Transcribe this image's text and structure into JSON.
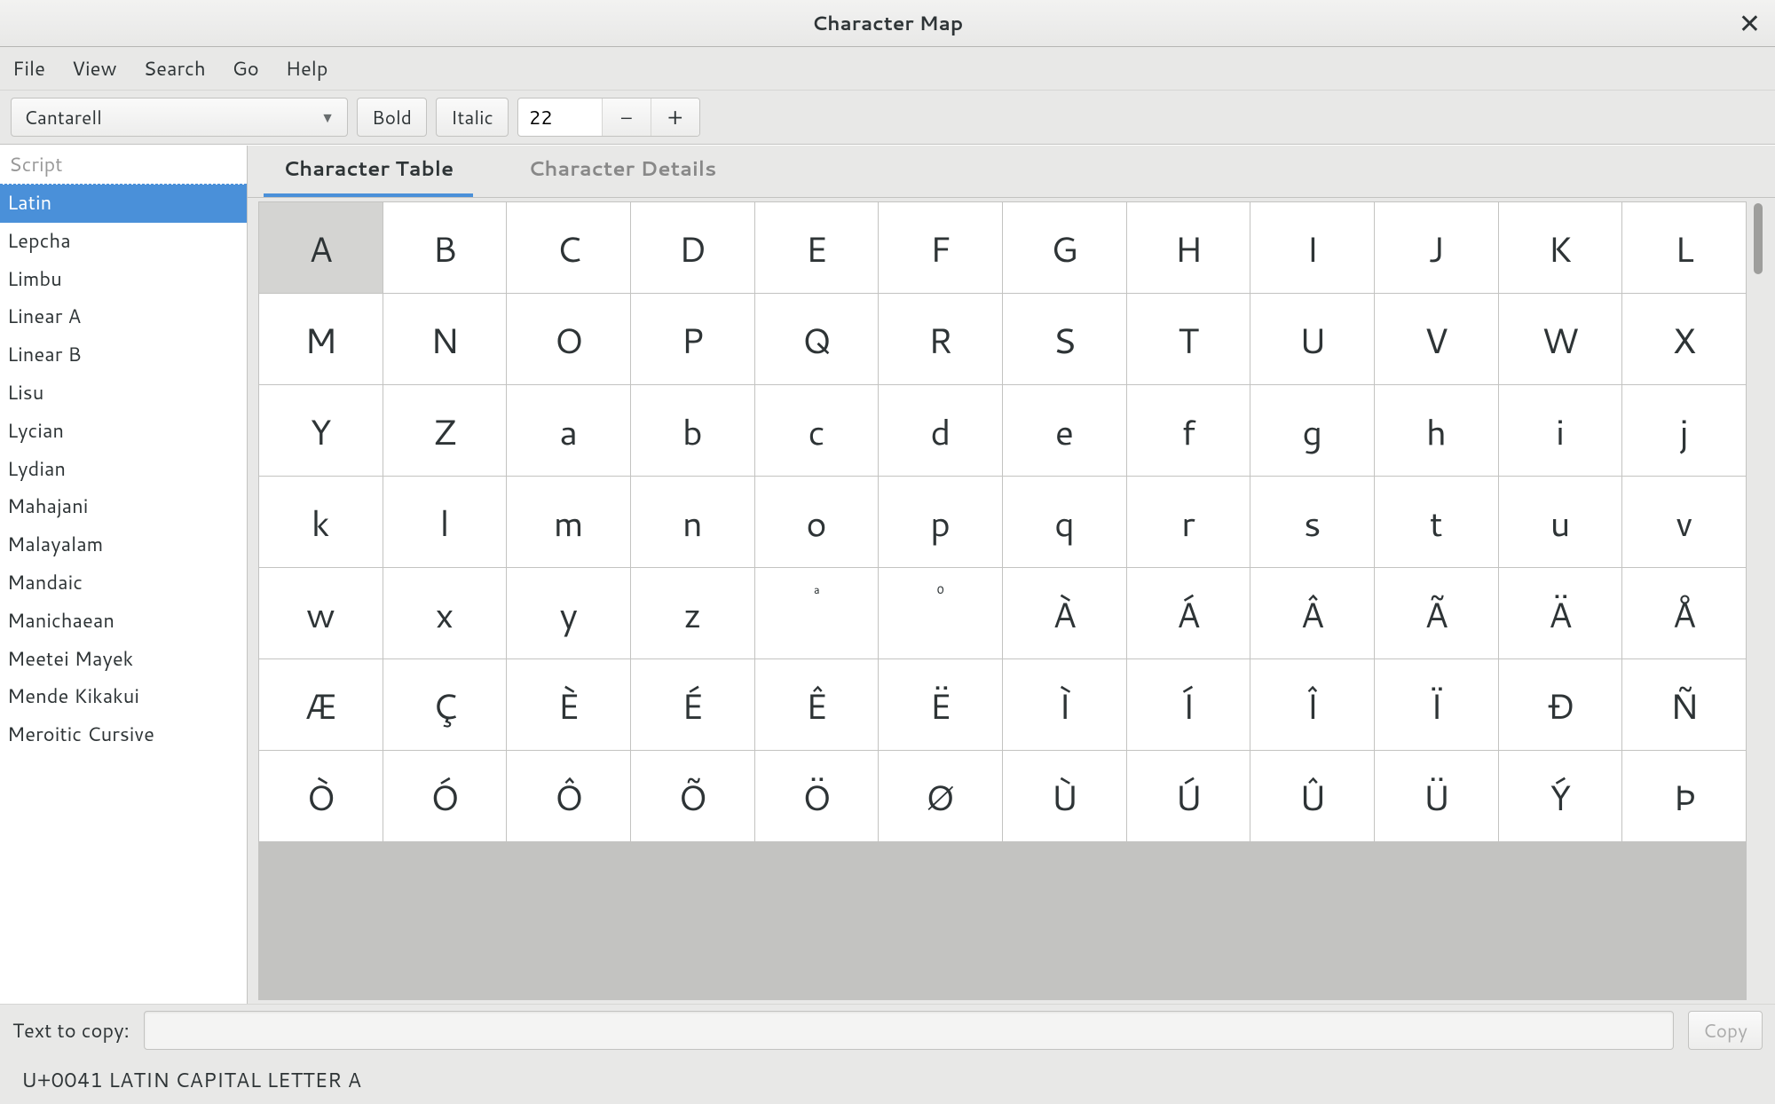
{
  "window": {
    "title": "Character Map"
  },
  "menubar": [
    "File",
    "View",
    "Search",
    "Go",
    "Help"
  ],
  "toolbar": {
    "font": "Cantarell",
    "bold": "Bold",
    "italic": "Italic",
    "size": "22"
  },
  "sidebar": {
    "header": "Script",
    "items": [
      "Latin",
      "Lepcha",
      "Limbu",
      "Linear A",
      "Linear B",
      "Lisu",
      "Lycian",
      "Lydian",
      "Mahajani",
      "Malayalam",
      "Mandaic",
      "Manichaean",
      "Meetei Mayek",
      "Mende Kikakui",
      "Meroitic Cursive"
    ],
    "selected": 0
  },
  "tabs": [
    {
      "label": "Character Table",
      "active": true
    },
    {
      "label": "Character Details",
      "active": false
    }
  ],
  "chars": {
    "cols": 12,
    "selected": 0,
    "cells": [
      "A",
      "B",
      "C",
      "D",
      "E",
      "F",
      "G",
      "H",
      "I",
      "J",
      "K",
      "L",
      "M",
      "N",
      "O",
      "P",
      "Q",
      "R",
      "S",
      "T",
      "U",
      "V",
      "W",
      "X",
      "Y",
      "Z",
      "a",
      "b",
      "c",
      "d",
      "e",
      "f",
      "g",
      "h",
      "i",
      "j",
      "k",
      "l",
      "m",
      "n",
      "o",
      "p",
      "q",
      "r",
      "s",
      "t",
      "u",
      "v",
      "w",
      "x",
      "y",
      "z",
      "ª",
      "º",
      "À",
      "Á",
      "Â",
      "Ã",
      "Ä",
      "Å",
      "Æ",
      "Ç",
      "È",
      "É",
      "Ê",
      "Ë",
      "Ì",
      "Í",
      "Î",
      "Ï",
      "Ð",
      "Ñ",
      "Ò",
      "Ó",
      "Ô",
      "Õ",
      "Ö",
      "Ø",
      "Ù",
      "Ú",
      "Û",
      "Ü",
      "Ý",
      "Þ"
    ],
    "ordinal_indices": [
      52,
      53
    ]
  },
  "copy": {
    "label": "Text to copy:",
    "value": "",
    "button": "Copy"
  },
  "status": "U+0041 LATIN CAPITAL LETTER A"
}
